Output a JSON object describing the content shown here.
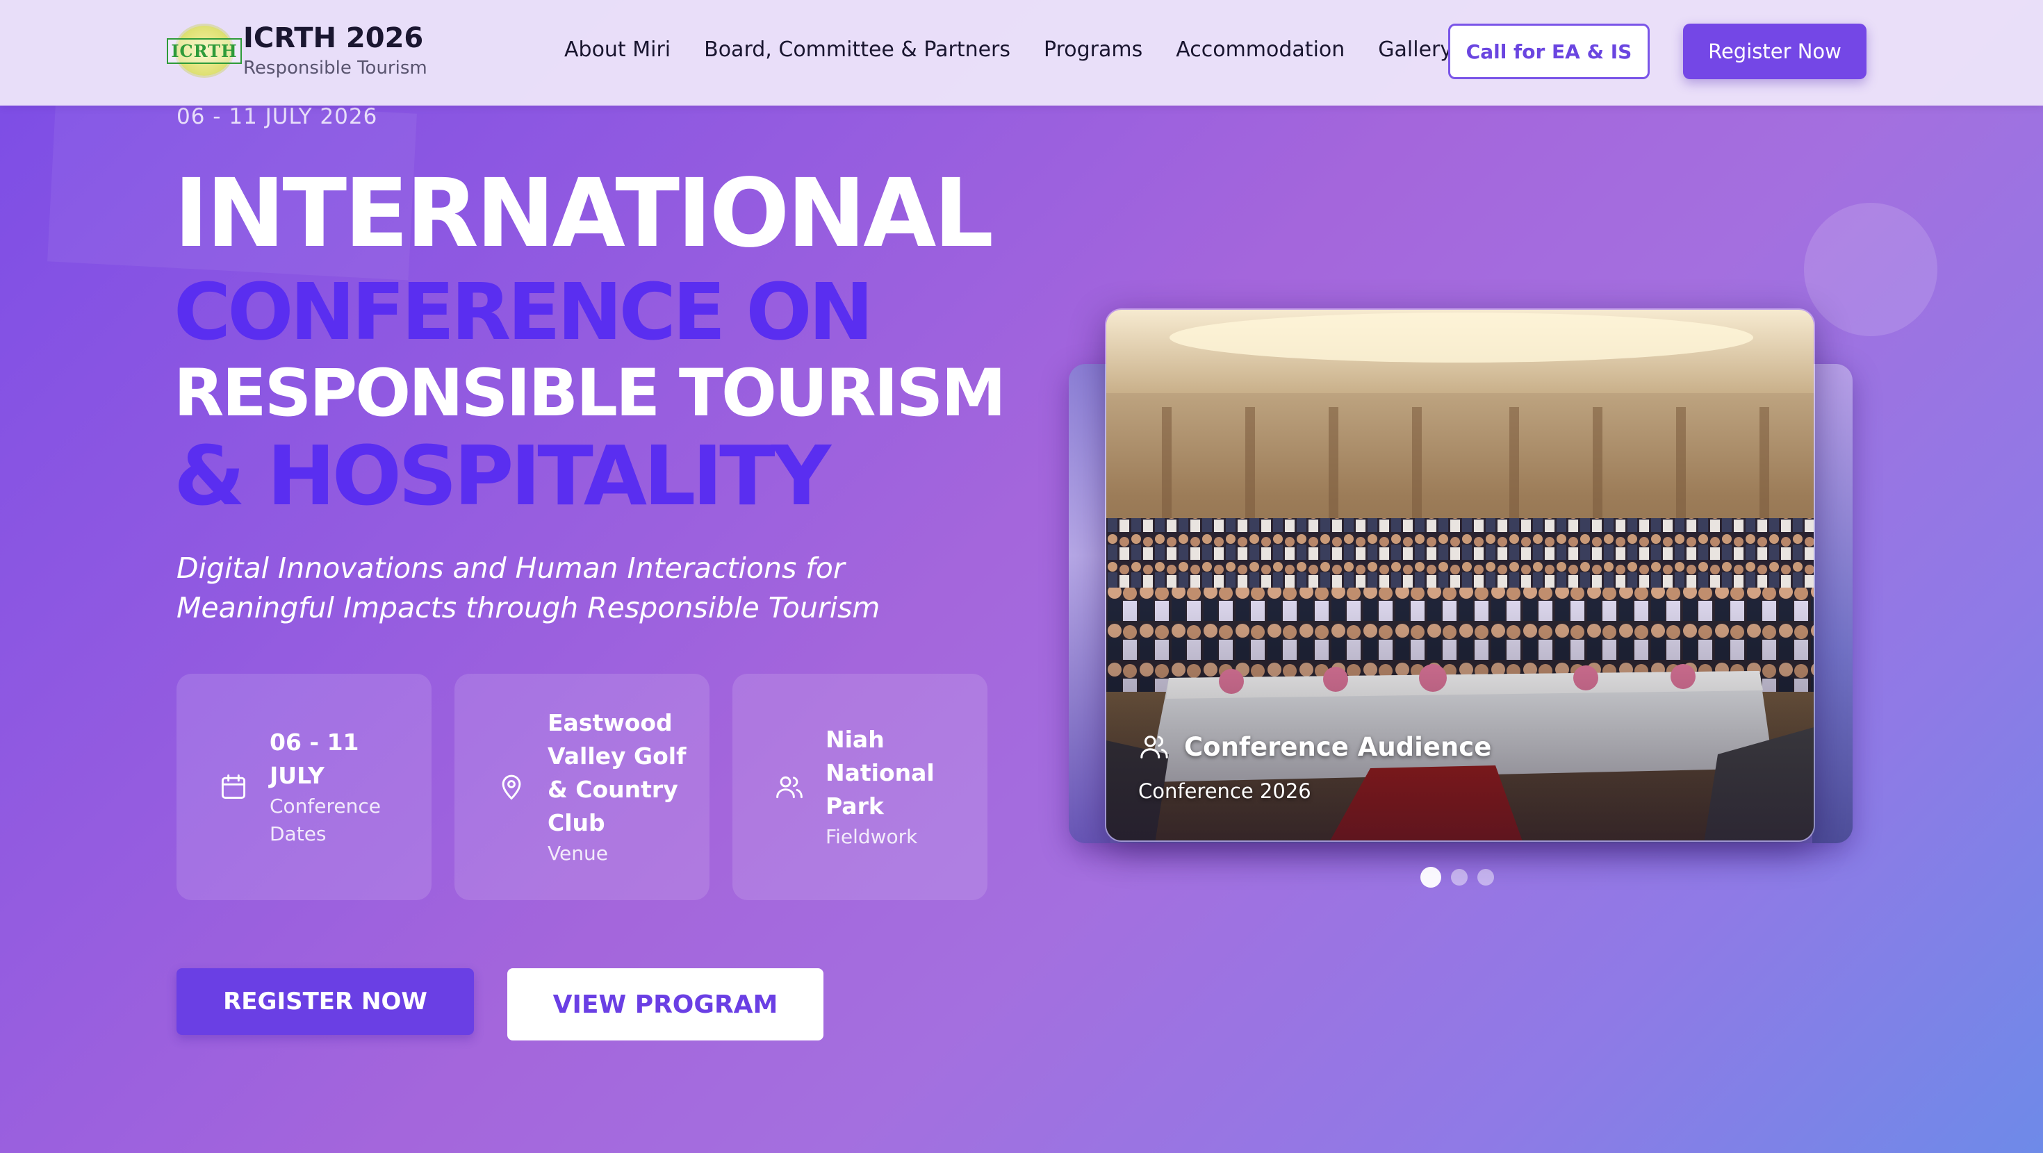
{
  "header": {
    "logo_text": "ICRTH",
    "brand_title": "ICRTH 2026",
    "brand_subtitle": "Responsible Tourism",
    "nav": [
      {
        "label": "About Miri"
      },
      {
        "label": "Board, Committee & Partners"
      },
      {
        "label": "Programs"
      },
      {
        "label": "Accommodation"
      },
      {
        "label": "Gallery"
      }
    ],
    "call_button": "Call for EA & IS",
    "register_button": "Register Now"
  },
  "hero": {
    "date_top": "06 - 11 JULY 2026",
    "title_line1": "INTERNATIONAL",
    "title_line2": "CONFERENCE ON",
    "title_line3": "RESPONSIBLE TOURISM",
    "title_line4": "& HOSPITALITY",
    "tagline": "Digital Innovations and Human Interactions for Meaningful Impacts through Responsible Tourism",
    "cards": [
      {
        "icon": "calendar-icon",
        "main": "06 - 11 JULY",
        "sub": "Conference Dates"
      },
      {
        "icon": "location-pin-icon",
        "main": "Eastwood Valley Golf & Country Club",
        "sub": "Venue"
      },
      {
        "icon": "users-icon",
        "main": "Niah National Park",
        "sub": "Fieldwork"
      }
    ],
    "cta_register": "REGISTER NOW",
    "cta_program": "VIEW PROGRAM"
  },
  "carousel": {
    "caption_title": "Conference Audience",
    "caption_sub": "Conference 2026",
    "active_index": 0,
    "slide_count": 3
  },
  "colors": {
    "accent": "#7447e6",
    "title_purple": "#5a2ef0",
    "header_bg": "#ece4fa"
  }
}
